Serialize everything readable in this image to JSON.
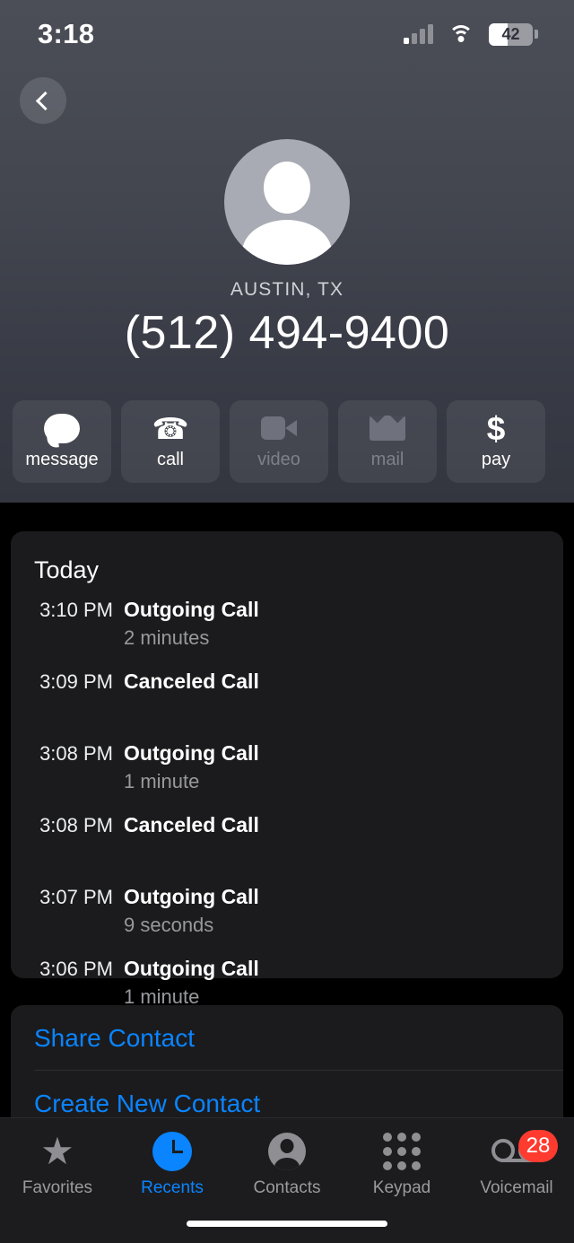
{
  "status_bar": {
    "time": "3:18",
    "battery_percent": "42",
    "signal_icon": "cellular-signal-icon",
    "wifi_icon": "wifi-icon",
    "battery_icon": "battery-icon"
  },
  "nav": {
    "back_label": "back-chevron"
  },
  "contact": {
    "avatar_icon": "person-placeholder-avatar",
    "city": "AUSTIN, TX",
    "phone_number": "(512) 494-9400"
  },
  "quick_actions": [
    {
      "label": "message",
      "icon": "message-bubble-icon",
      "enabled": true
    },
    {
      "label": "call",
      "icon": "phone-handset-icon",
      "enabled": true
    },
    {
      "label": "video",
      "icon": "video-camera-icon",
      "enabled": false
    },
    {
      "label": "mail",
      "icon": "envelope-icon",
      "enabled": false
    },
    {
      "label": "pay",
      "icon": "dollar-sign-icon",
      "enabled": true
    }
  ],
  "history": {
    "section_title": "Today",
    "entries": [
      {
        "time": "3:10 PM",
        "type": "Outgoing Call",
        "duration": "2 minutes"
      },
      {
        "time": "3:09 PM",
        "type": "Canceled Call",
        "duration": ""
      },
      {
        "time": "3:08 PM",
        "type": "Outgoing Call",
        "duration": "1 minute"
      },
      {
        "time": "3:08 PM",
        "type": "Canceled Call",
        "duration": ""
      },
      {
        "time": "3:07 PM",
        "type": "Outgoing Call",
        "duration": "9 seconds"
      },
      {
        "time": "3:06 PM",
        "type": "Outgoing Call",
        "duration": "1 minute"
      }
    ]
  },
  "contact_actions": [
    {
      "label": "Share Contact"
    },
    {
      "label": "Create New Contact"
    }
  ],
  "tab_bar": {
    "items": [
      {
        "label": "Favorites",
        "icon": "star-icon",
        "active": false,
        "badge": ""
      },
      {
        "label": "Recents",
        "icon": "clock-icon",
        "active": true,
        "badge": ""
      },
      {
        "label": "Contacts",
        "icon": "person-icon",
        "active": false,
        "badge": ""
      },
      {
        "label": "Keypad",
        "icon": "keypad-icon",
        "active": false,
        "badge": ""
      },
      {
        "label": "Voicemail",
        "icon": "voicemail-icon",
        "active": false,
        "badge": "28"
      }
    ]
  },
  "colors": {
    "accent_blue": "#0a84ff",
    "badge_red": "#ff3b30",
    "card_bg": "#1b1b1d",
    "header_top": "#4b4e57",
    "header_bottom": "#33363f"
  }
}
